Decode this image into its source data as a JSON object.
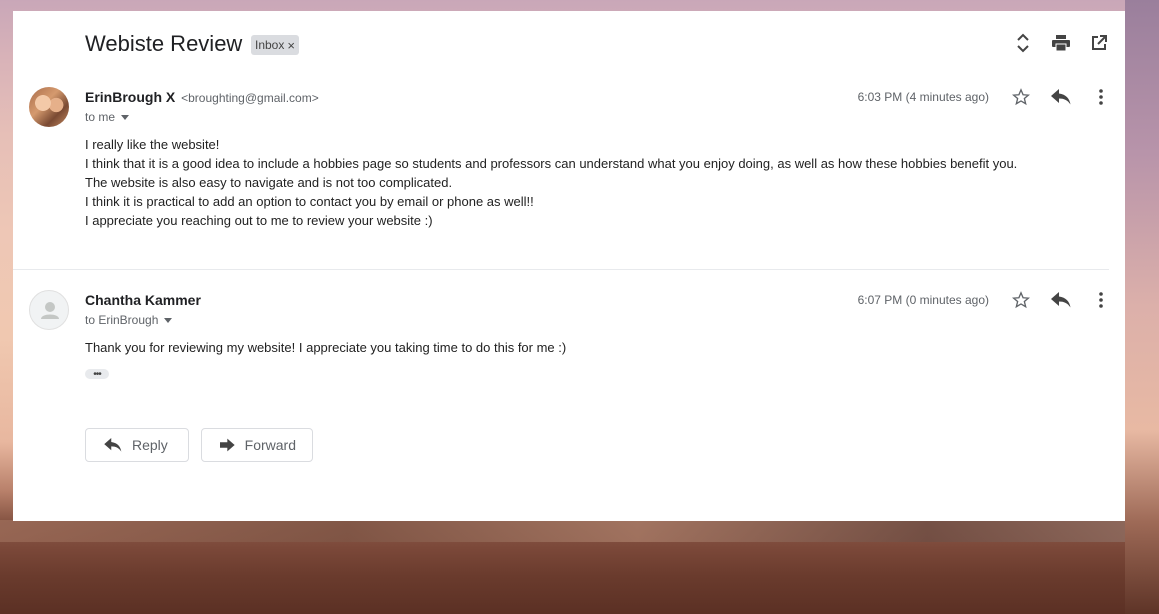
{
  "thread": {
    "subject": "Webiste Review",
    "label": "Inbox",
    "label_remove": "×"
  },
  "messages": [
    {
      "sender_name": "ErinBrough X",
      "sender_email": "<broughting@gmail.com>",
      "recipient": "to me",
      "time": "6:03 PM (4 minutes ago)",
      "body": [
        "I really like the website!",
        "I think that it is a good idea to include a hobbies page so students and professors can understand what you enjoy doing, as well as how these hobbies benefit you.",
        "The website is also easy to navigate and is not too complicated.",
        "I think it is practical to add an option to contact you by email or phone as well!!",
        "I appreciate you reaching out to me to review your website :)"
      ]
    },
    {
      "sender_name": "Chantha Kammer",
      "recipient": "to ErinBrough",
      "time": "6:07 PM (0 minutes ago)",
      "body": [
        "Thank you for reviewing my website! I appreciate you taking time to do this for me :)"
      ],
      "trimmed_content": "•••"
    }
  ],
  "actions": {
    "reply_label": "Reply",
    "forward_label": "Forward"
  },
  "icons": {
    "expand": "expand-collapse-icon",
    "print": "print-icon",
    "new_window": "open-in-new-window-icon",
    "star": "star-icon",
    "reply": "reply-icon",
    "more": "more-vert-icon",
    "dropdown": "arrow-drop-down-icon",
    "forward": "forward-icon"
  },
  "colors": {
    "text_primary": "#202124",
    "text_secondary": "#5f6368",
    "chip_bg": "#dadce0"
  }
}
